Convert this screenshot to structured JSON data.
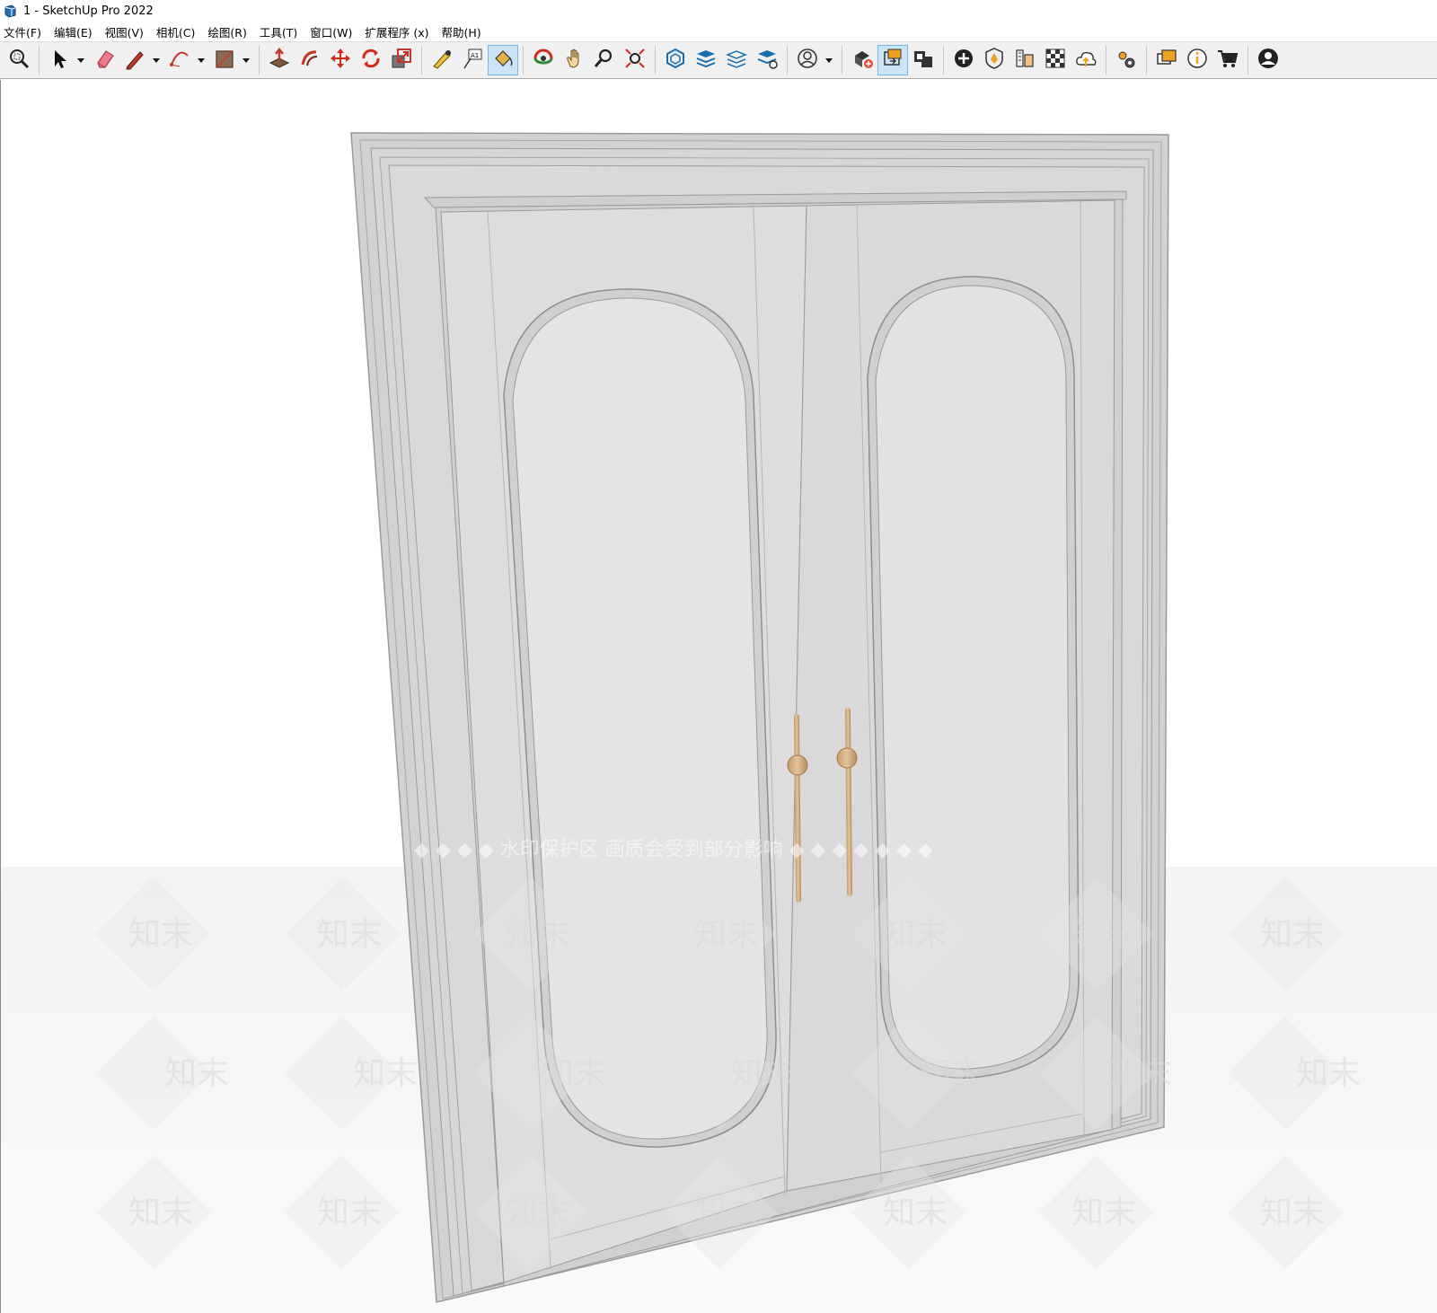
{
  "window": {
    "title": "1 - SketchUp Pro 2022"
  },
  "menubar": {
    "items": [
      "文件(F)",
      "编辑(E)",
      "视图(V)",
      "相机(C)",
      "绘图(R)",
      "工具(T)",
      "窗口(W)",
      "扩展程序 (x)",
      "帮助(H)"
    ]
  },
  "toolbar": {
    "tools": [
      {
        "icon": "zoom-window-icon"
      },
      {
        "icon": "select-icon",
        "dropdown": true
      },
      {
        "icon": "eraser-icon"
      },
      {
        "icon": "pencil-line-icon",
        "dropdown": true
      },
      {
        "icon": "arc-icon",
        "dropdown": true
      },
      {
        "icon": "rectangle-icon",
        "dropdown": true
      },
      {
        "icon": "push-pull-icon"
      },
      {
        "icon": "offset-icon"
      },
      {
        "icon": "move-icon"
      },
      {
        "icon": "rotate-icon"
      },
      {
        "icon": "scale-icon"
      },
      {
        "icon": "tape-measure-icon"
      },
      {
        "icon": "text-icon"
      },
      {
        "icon": "paint-bucket-icon",
        "active": true
      },
      {
        "icon": "orbit-icon"
      },
      {
        "icon": "pan-icon"
      },
      {
        "icon": "zoom-icon"
      },
      {
        "icon": "zoom-extents-icon"
      },
      {
        "icon": "warehouse-3d-icon"
      },
      {
        "icon": "extension-warehouse-icon"
      },
      {
        "icon": "layout-send-icon"
      },
      {
        "icon": "extension-manager-icon"
      },
      {
        "icon": "account-icon",
        "dropdown": true
      },
      {
        "icon": "add-location-icon"
      },
      {
        "icon": "sandbox-icon",
        "active": true
      },
      {
        "icon": "scene-camera-icon"
      },
      {
        "icon": "add-icon"
      },
      {
        "icon": "solid-inspector-icon"
      },
      {
        "icon": "profile-builder-icon"
      },
      {
        "icon": "checker-icon"
      },
      {
        "icon": "cloud-upload-icon"
      },
      {
        "icon": "settings-gears-icon"
      },
      {
        "icon": "comments-icon"
      },
      {
        "icon": "info-icon"
      },
      {
        "icon": "cart-icon"
      },
      {
        "icon": "user-profile-icon"
      }
    ]
  },
  "viewport": {
    "model": "double-door",
    "watermark": {
      "banner": "◆ ◆ ◆ ◆ 水印保护区   画质会受到部分影响 ◆ ◆ ◆ ◆ ◆ ◆ ◆",
      "mark": "知末"
    },
    "colors": {
      "background": "#ffffff",
      "door": "#dcdcdc",
      "frame": "#d4d4d4",
      "glass": "#e4e4e4",
      "handle": "#d8b68e",
      "edge": "#8f8f8f"
    }
  }
}
